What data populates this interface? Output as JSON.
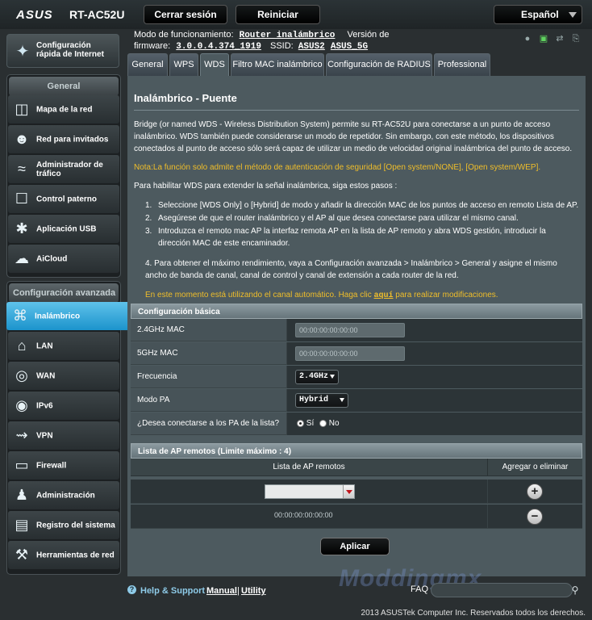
{
  "header": {
    "brand": "ASUS",
    "model": "RT-AC52U",
    "logout_label": "Cerrar sesión",
    "reboot_label": "Reiniciar",
    "language": "Español"
  },
  "info": {
    "mode_label": "Modo de funcionamiento:",
    "mode_value": "Router inalámbrico",
    "version_label": "Versión de",
    "firmware_label": "firmware:",
    "firmware_value": "3.0.0.4.374_1919",
    "ssid_label": "SSID:",
    "ssid_1": "ASUS2",
    "ssid_2": "ASUS_5G"
  },
  "sidebar": {
    "quick_setup": "Configuración rápida de Internet",
    "general_title": "General",
    "general_items": [
      {
        "label": "Mapa de la red",
        "icon": "network-map-icon"
      },
      {
        "label": "Red para invitados",
        "icon": "guest-network-icon"
      },
      {
        "label": "Administrador de tráfico",
        "icon": "traffic-manager-icon"
      },
      {
        "label": "Control paterno",
        "icon": "parental-control-icon"
      },
      {
        "label": "Aplicación USB",
        "icon": "usb-app-icon"
      },
      {
        "label": "AiCloud",
        "icon": "aicloud-icon"
      }
    ],
    "advanced_title": "Configuración avanzada",
    "advanced_items": [
      {
        "label": "Inalámbrico",
        "icon": "wireless-icon",
        "active": true
      },
      {
        "label": "LAN",
        "icon": "lan-icon"
      },
      {
        "label": "WAN",
        "icon": "wan-icon"
      },
      {
        "label": "IPv6",
        "icon": "ipv6-icon"
      },
      {
        "label": "VPN",
        "icon": "vpn-icon"
      },
      {
        "label": "Firewall",
        "icon": "firewall-icon"
      },
      {
        "label": "Administración",
        "icon": "administration-icon"
      },
      {
        "label": "Registro del sistema",
        "icon": "system-log-icon"
      },
      {
        "label": "Herramientas de red",
        "icon": "network-tools-icon"
      }
    ]
  },
  "tabs": [
    "General",
    "WPS",
    "WDS",
    "Filtro MAC inalámbrico",
    "Configuración de RADIUS",
    "Professional"
  ],
  "active_tab": "WDS",
  "main": {
    "title": "Inalámbrico - Puente",
    "intro": "Bridge (or named WDS - Wireless Distribution System) permite su RT-AC52U para conectarse a un punto de acceso inalámbrico. WDS también puede considerarse un modo de repetidor. Sin embargo, con este método, los dispositivos conectados al punto de acceso sólo será capaz de utilizar un medio de velocidad original inalámbrica del punto de acceso.",
    "note": "Nota:La función solo admite el método de autenticación de seguridad [Open system/NONE], [Open system/WEP].",
    "steps_intro": "Para habilitar WDS para extender la señal inalámbrica, siga estos pasos :",
    "step1": "Seleccione [WDS Only] o [Hybrid] de modo y añadir la dirección MAC de los puntos de acceso en remoto Lista de AP.",
    "step2": "Asegúrese de que el router inalámbrico y el AP al que desea conectarse para utilizar el mismo canal.",
    "step3": "Introduzca el remoto mac AP la interfaz remota AP en la lista de AP remoto y abra WDS gestión, introducir la dirección MAC de este encaminador.",
    "step4": "4. Para obtener el máximo rendimiento, vaya a Configuración avanzada > Inalámbrico > General y asigne el mismo ancho de banda de canal, canal de control y canal de extensión a cada router de la red.",
    "channel_note_pre": "En este momento está utilizando el canal automático. Haga clic",
    "channel_link": "aquí",
    "channel_note_post": "para realizar modificaciones."
  },
  "basic_config": {
    "title": "Configuración básica",
    "mac24_label": "2.4GHz MAC",
    "mac24_value": "00:00:00:00:00:00",
    "mac5_label": "5GHz MAC",
    "mac5_value": "00:00:00:00:00:00",
    "freq_label": "Frecuencia",
    "freq_value": "2.4GHz",
    "mode_label": "Modo PA",
    "mode_value": "Hybrid",
    "connect_label": "¿Desea conectarse a los PA de la lista?",
    "yes": "Sí",
    "no": "No"
  },
  "ap_list": {
    "title": "Lista de AP remotos (Limite máximo : 4)",
    "col_list": "Lista de AP remotos",
    "col_action": "Agregar o eliminar",
    "entry_mac": "00:00:00:00:00:00"
  },
  "apply_label": "Aplicar",
  "footer": {
    "help": "Help & Support",
    "manual": "Manual",
    "separator": "|",
    "utility": "Utility",
    "faq": "FAQ",
    "watermark": "Moddingmx",
    "copyright": "2013 ASUSTek Computer Inc. Reservados todos los derechos."
  }
}
